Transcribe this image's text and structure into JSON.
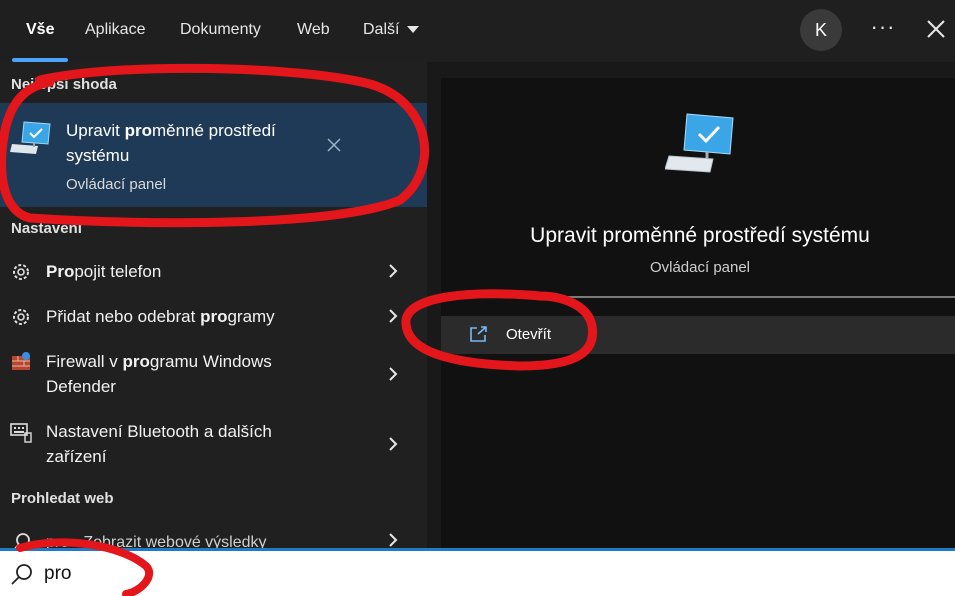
{
  "tabs": [
    {
      "label": "Vše",
      "active": true
    },
    {
      "label": "Aplikace"
    },
    {
      "label": "Dokumenty"
    },
    {
      "label": "Web"
    },
    {
      "label": "Další"
    }
  ],
  "header": {
    "avatar_letter": "K",
    "more_label": "···"
  },
  "left": {
    "best_match_heading": "Nejlepší shoda",
    "best_match": {
      "title_bold": "pro",
      "title_before": "Upravit ",
      "title_after": "měnné prostředí systému",
      "subtitle": "Ovládací panel"
    },
    "settings_heading": "Nastavení",
    "settings_items": [
      {
        "pre": "",
        "bold": "Pro",
        "post": "pojit telefon",
        "icon": "gear-icon"
      },
      {
        "pre": "Přidat nebo odebrat ",
        "bold": "pro",
        "post": "gramy",
        "icon": "gear-icon"
      },
      {
        "pre": "Firewall v ",
        "bold": "pro",
        "post": "gramu Windows Defender",
        "icon": "firewall-icon"
      },
      {
        "pre": "Nastavení Bluetooth a dalších zařízení",
        "bold": "",
        "post": "",
        "icon": "keyboard-device-icon"
      }
    ],
    "web_heading": "Prohledat web",
    "web_item": {
      "query": "pro",
      "suffix": " - Zobrazit webové výsledky"
    }
  },
  "right": {
    "title": "Upravit proměnné prostředí systému",
    "subtitle": "Ovládací panel",
    "open_label": "Otevřít"
  },
  "search": {
    "value": "pro"
  },
  "colors": {
    "accent": "#4aa3ff",
    "selected_bg": "#1e3a56",
    "annotation": "#e3161b"
  }
}
